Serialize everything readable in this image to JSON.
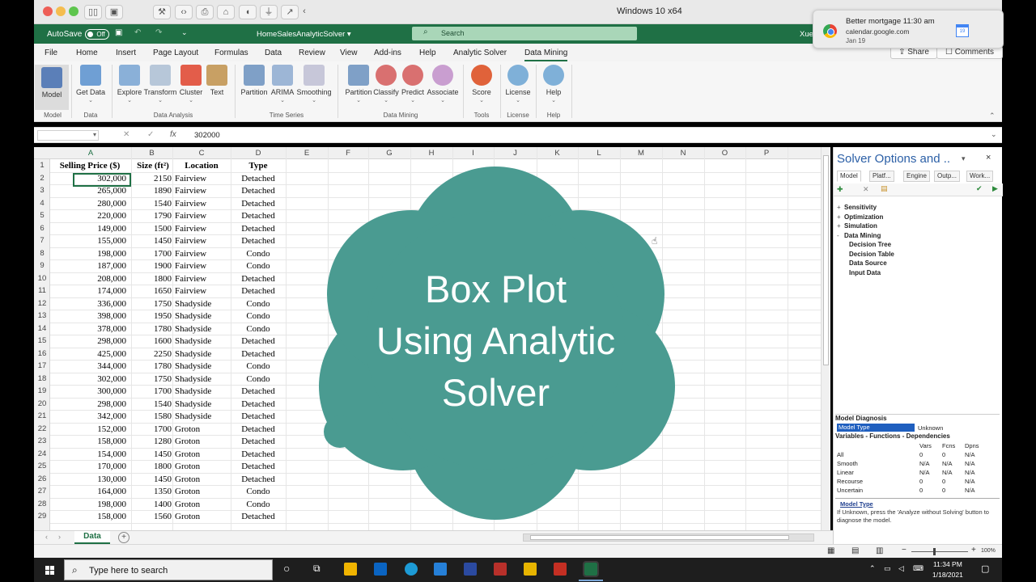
{
  "vm_window": {
    "title": "Windows 10 x64"
  },
  "excel": {
    "autosave_label": "AutoSave",
    "autosave_state": "Off",
    "doc_name": "HomeSalesAnalyticSolver ▾",
    "search_placeholder": "Search",
    "user": "Xue",
    "menu": [
      "File",
      "Home",
      "Insert",
      "Page Layout",
      "Formulas",
      "Data",
      "Review",
      "View",
      "Add-ins",
      "Help",
      "Analytic Solver",
      "Data Mining"
    ],
    "share_label": "Share",
    "comments_label": "Comments",
    "ribbon_buttons": [
      "Model",
      "Get Data",
      "Explore",
      "Transform",
      "Cluster",
      "Text",
      "Partition",
      "ARIMA",
      "Smoothing",
      "Partition",
      "Classify",
      "Predict",
      "Associate",
      "Score",
      "License",
      "Help"
    ],
    "ribbon_groups": [
      "Model",
      "Data",
      "Data Analysis",
      "Time Series",
      "Data Mining",
      "Tools",
      "License",
      "Help"
    ],
    "formula_value": "302000",
    "fx_label": "fx",
    "columns": [
      "A",
      "B",
      "C",
      "D",
      "E",
      "F",
      "G",
      "H",
      "I",
      "J",
      "K",
      "L",
      "M",
      "N",
      "O",
      "P"
    ],
    "header_row": [
      "Selling Price ($)",
      "Size (ft²)",
      "Location",
      "Type"
    ],
    "rows": [
      [
        "302,000",
        "2150",
        "Fairview",
        "Detached"
      ],
      [
        "265,000",
        "1890",
        "Fairview",
        "Detached"
      ],
      [
        "280,000",
        "1540",
        "Fairview",
        "Detached"
      ],
      [
        "220,000",
        "1790",
        "Fairview",
        "Detached"
      ],
      [
        "149,000",
        "1500",
        "Fairview",
        "Detached"
      ],
      [
        "155,000",
        "1450",
        "Fairview",
        "Detached"
      ],
      [
        "198,000",
        "1700",
        "Fairview",
        "Condo"
      ],
      [
        "187,000",
        "1900",
        "Fairview",
        "Condo"
      ],
      [
        "208,000",
        "1800",
        "Fairview",
        "Detached"
      ],
      [
        "174,000",
        "1650",
        "Fairview",
        "Detached"
      ],
      [
        "336,000",
        "1750",
        "Shadyside",
        "Condo"
      ],
      [
        "398,000",
        "1950",
        "Shadyside",
        "Condo"
      ],
      [
        "378,000",
        "1780",
        "Shadyside",
        "Condo"
      ],
      [
        "298,000",
        "1600",
        "Shadyside",
        "Detached"
      ],
      [
        "425,000",
        "2250",
        "Shadyside",
        "Detached"
      ],
      [
        "344,000",
        "1780",
        "Shadyside",
        "Condo"
      ],
      [
        "302,000",
        "1750",
        "Shadyside",
        "Condo"
      ],
      [
        "300,000",
        "1700",
        "Shadyside",
        "Detached"
      ],
      [
        "298,000",
        "1540",
        "Shadyside",
        "Detached"
      ],
      [
        "342,000",
        "1580",
        "Shadyside",
        "Detached"
      ],
      [
        "152,000",
        "1700",
        "Groton",
        "Detached"
      ],
      [
        "158,000",
        "1280",
        "Groton",
        "Detached"
      ],
      [
        "154,000",
        "1450",
        "Groton",
        "Detached"
      ],
      [
        "170,000",
        "1800",
        "Groton",
        "Detached"
      ],
      [
        "130,000",
        "1450",
        "Groton",
        "Detached"
      ],
      [
        "164,000",
        "1350",
        "Groton",
        "Condo"
      ],
      [
        "198,000",
        "1400",
        "Groton",
        "Condo"
      ],
      [
        "158,000",
        "1560",
        "Groton",
        "Detached"
      ]
    ],
    "sheet_tab": "Data",
    "zoom": "100%"
  },
  "solver": {
    "title": "Solver Options and ..",
    "tabs": [
      "Model",
      "Platf...",
      "Engine",
      "Outp...",
      "Work..."
    ],
    "tree": [
      {
        "label": "Sensitivity",
        "exp": "+"
      },
      {
        "label": "Optimization",
        "exp": "+"
      },
      {
        "label": "Simulation",
        "exp": "+"
      },
      {
        "label": "Data Mining",
        "exp": "-"
      },
      {
        "label": "Decision Tree",
        "exp": " "
      },
      {
        "label": "Decision Table",
        "exp": " "
      },
      {
        "label": "Data Source",
        "exp": " "
      },
      {
        "label": "Input Data",
        "exp": " "
      }
    ],
    "diag_title": "Model Diagnosis",
    "model_type_label": "Model Type",
    "model_type_value": "Unknown",
    "vfd_title": "Variables - Functions - Dependencies",
    "vfd_cols": [
      "Vars",
      "Fcns",
      "Dpns"
    ],
    "vfd_rows": [
      {
        "name": "All",
        "v": "0",
        "f": "0",
        "d": "N/A"
      },
      {
        "name": "Smooth",
        "v": "N/A",
        "f": "N/A",
        "d": "N/A"
      },
      {
        "name": "Linear",
        "v": "N/A",
        "f": "N/A",
        "d": "N/A"
      },
      {
        "name": "Recourse",
        "v": "0",
        "f": "0",
        "d": "N/A"
      },
      {
        "name": "Uncertain",
        "v": "0",
        "f": "0",
        "d": "N/A"
      }
    ],
    "help_title": "Model Type",
    "help_text": "If Unknown, press the 'Analyze without Solving' button to diagnose the model."
  },
  "notification": {
    "title": "Better mortgage 11:30 am",
    "source": "calendar.google.com",
    "date": "Jan 19",
    "cal_day": "19"
  },
  "taskbar": {
    "search_placeholder": "Type here to search",
    "time": "11:34 PM",
    "date": "1/18/2021"
  },
  "overlay": {
    "line1": "Box Plot",
    "line2": "Using Analytic",
    "line3": "Solver"
  },
  "colors": {
    "excel_green": "#1f7045",
    "overlay_teal": "#4a9b91"
  }
}
